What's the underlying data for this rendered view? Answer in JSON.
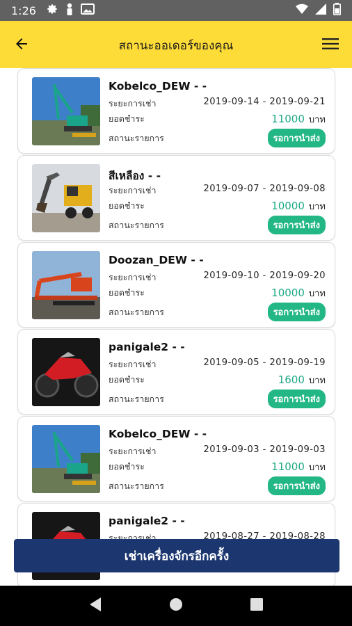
{
  "status_bar": {
    "time": "1:26"
  },
  "app_bar": {
    "title": "สถานะออเดอร์ของคุณ"
  },
  "labels": {
    "period": "ระยะการเช่า",
    "amount_due": "ยอดชำระ",
    "item_status": "สถานะรายการ",
    "currency": "บาท"
  },
  "orders": [
    {
      "name": "Kobelco_DEW - -",
      "dates": "2019-09-14 - 2019-09-21",
      "price": "11000",
      "status": "รอการนำส่ง",
      "image": "excavator-long-reach"
    },
    {
      "name": "สีเหลือง - -",
      "dates": "2019-09-07 - 2019-09-08",
      "price": "10000",
      "status": "รอการนำส่ง",
      "image": "yellow-wheeled-excavator"
    },
    {
      "name": "Doozan_DEW - -",
      "dates": "2019-09-10 - 2019-09-20",
      "price": "10000",
      "status": "รอการนำส่ง",
      "image": "orange-excavator-on-trailer"
    },
    {
      "name": "panigale2 - -",
      "dates": "2019-09-05 - 2019-09-19",
      "price": "1600",
      "status": "รอการนำส่ง",
      "image": "red-motorcycle"
    },
    {
      "name": "Kobelco_DEW - -",
      "dates": "2019-09-03 - 2019-09-03",
      "price": "11000",
      "status": "รอการนำส่ง",
      "image": "excavator-long-reach"
    },
    {
      "name": "panigale2 - -",
      "dates": "2019-08-27 - 2019-08-28",
      "price": "",
      "status": "",
      "image": "red-motorcycle"
    }
  ],
  "cta": {
    "label": "เช่าเครื่องจักรอีกครั้ง"
  },
  "colors": {
    "app_bar": "#fedc38",
    "accent_green": "#22b784",
    "price_green": "#1faa85",
    "cta_blue": "#1c3770",
    "status_bar": "#616161"
  }
}
